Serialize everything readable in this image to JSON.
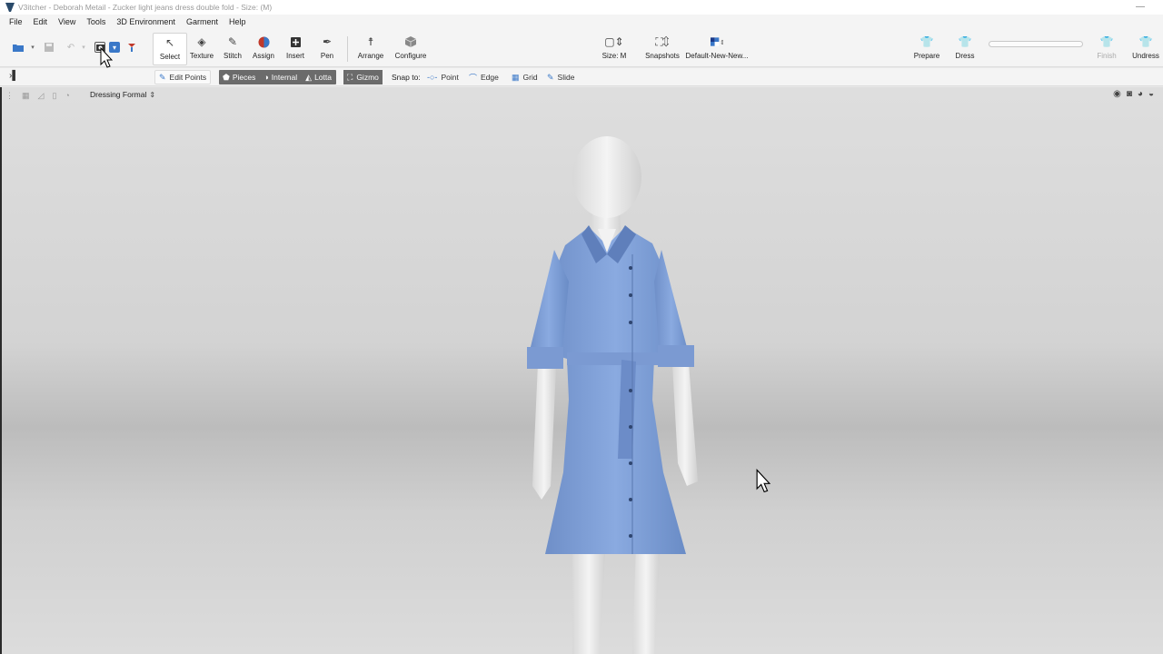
{
  "window": {
    "title": "V3itcher - Deborah Metail - Zucker light jeans dress double fold - Size: (M)",
    "controls": "—"
  },
  "menu": [
    "File",
    "Edit",
    "View",
    "Tools",
    "3D Environment",
    "Garment",
    "Help"
  ],
  "toolbar": {
    "tools": [
      {
        "label": "Select",
        "icon": "select-arrow-icon"
      },
      {
        "label": "Texture",
        "icon": "texture-icon"
      },
      {
        "label": "Stitch",
        "icon": "stitch-icon"
      },
      {
        "label": "Assign",
        "icon": "assign-icon"
      },
      {
        "label": "Insert",
        "icon": "insert-icon"
      },
      {
        "label": "Pen",
        "icon": "pen-icon"
      },
      {
        "label": "Arrange",
        "icon": "arrange-icon"
      },
      {
        "label": "Configure",
        "icon": "configure-icon"
      }
    ],
    "size_label": "Size: M",
    "snapshots_label": "Snapshots",
    "environment_label": "Default-New-New...",
    "prepare_label": "Prepare",
    "dress_label": "Dress",
    "finish_label": "Finish",
    "undress_label": "Undress",
    "progress": 0
  },
  "options": {
    "edit_points": "Edit Points",
    "pieces": "Pieces",
    "internal": "Internal",
    "lotta": "Lotta",
    "gizmo": "Gizmo",
    "snap_to": "Snap to:",
    "snap_point": "Point",
    "snap_edge": "Edge",
    "snap_grid": "Grid",
    "snap_slide": "Slide"
  },
  "viewport": {
    "dressing_mode": "Dressing Formal",
    "colors": {
      "garment": "#7d9fd6",
      "avatar": "#ececec"
    }
  }
}
